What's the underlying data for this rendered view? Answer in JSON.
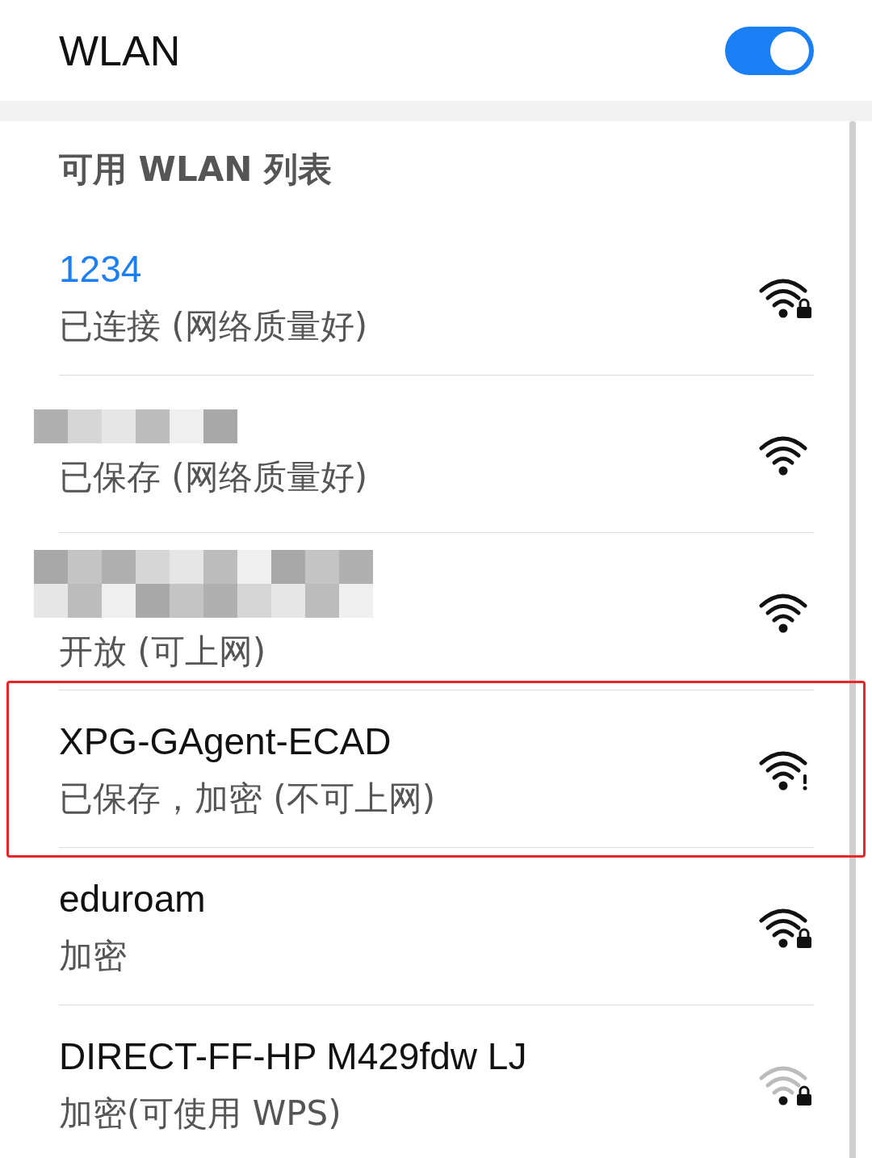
{
  "header": {
    "title": "WLAN",
    "switch": {
      "on": true
    }
  },
  "section_title": "可用 WLAN 列表",
  "networks": [
    {
      "name": "1234",
      "connected": true,
      "status": "已连接 (网络质量好)",
      "weak_signal": false,
      "locked": true,
      "alert": false,
      "highlighted": false
    },
    {
      "connected": false,
      "status": "已保存 (网络质量好)",
      "weak_signal": false,
      "locked": false,
      "alert": false,
      "highlighted": false
    },
    {
      "connected": false,
      "status": "开放 (可上网)",
      "weak_signal": false,
      "locked": false,
      "alert": false,
      "highlighted": false
    },
    {
      "name": "XPG-GAgent-ECAD",
      "connected": false,
      "status": "已保存，加密 (不可上网)",
      "weak_signal": false,
      "locked": false,
      "alert": true,
      "highlighted": true
    },
    {
      "name": "eduroam",
      "connected": false,
      "status": "加密",
      "weak_signal": false,
      "locked": true,
      "alert": false,
      "highlighted": false
    },
    {
      "name": "DIRECT-FF-HP M429fdw LJ",
      "connected": false,
      "status": "加密(可使用 WPS)",
      "weak_signal": true,
      "locked": true,
      "alert": false,
      "highlighted": false
    }
  ]
}
